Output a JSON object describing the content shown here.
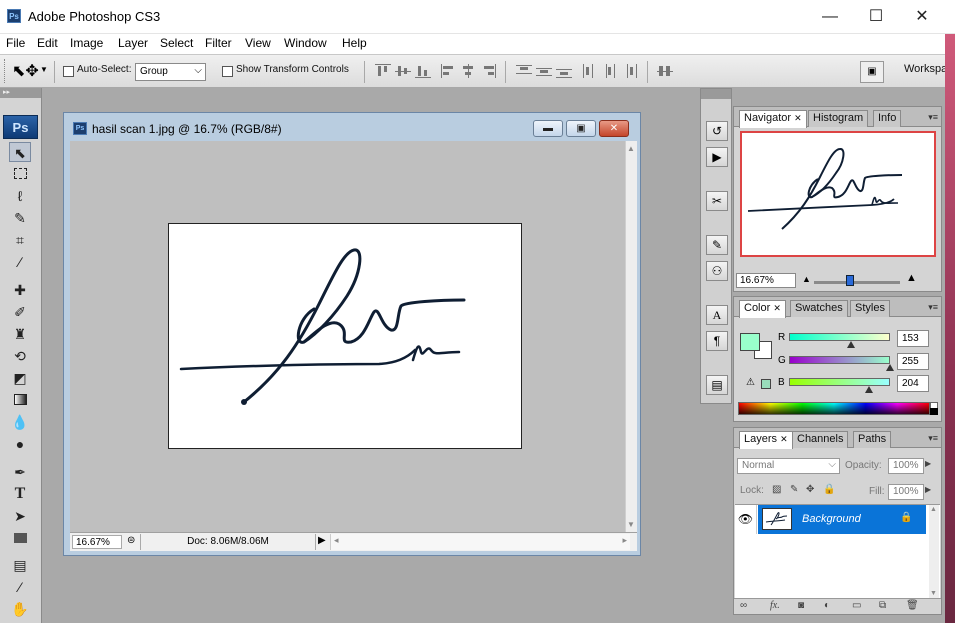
{
  "app": {
    "title": "Adobe Photoshop CS3",
    "logo": "Ps"
  },
  "window_controls": {
    "minimize": "—",
    "maximize": "☐",
    "close": "✕"
  },
  "menu": [
    "File",
    "Edit",
    "Image",
    "Layer",
    "Select",
    "Filter",
    "View",
    "Window",
    "Help"
  ],
  "options": {
    "auto_select_label": "Auto-Select:",
    "auto_select_value": "Group",
    "show_transform_label": "Show Transform Controls",
    "workspace_label": "Workspa"
  },
  "toolbox": {
    "logo": "Ps"
  },
  "document": {
    "title": "hasil scan 1.jpg @ 16.7% (RGB/8#)",
    "zoom": "16.67%",
    "doc_size": "Doc: 8.06M/8.06M"
  },
  "navigator": {
    "tabs": [
      "Navigator",
      "Histogram",
      "Info"
    ],
    "zoom": "16.67%"
  },
  "color_panel": {
    "tabs": [
      "Color",
      "Swatches",
      "Styles"
    ],
    "r_label": "R",
    "g_label": "G",
    "b_label": "B",
    "r": "153",
    "g": "255",
    "b": "204",
    "foreground": "#99ffcc"
  },
  "layers_panel": {
    "tabs": [
      "Layers",
      "Channels",
      "Paths"
    ],
    "blend_mode": "Normal",
    "opacity_label": "Opacity:",
    "opacity": "100%",
    "lock_label": "Lock:",
    "fill_label": "Fill:",
    "fill": "100%",
    "layer_name": "Background"
  },
  "colors": {
    "selection": "#0a74d8",
    "titlebar": "#ffffff",
    "accent_pink": "#d05a7a"
  }
}
